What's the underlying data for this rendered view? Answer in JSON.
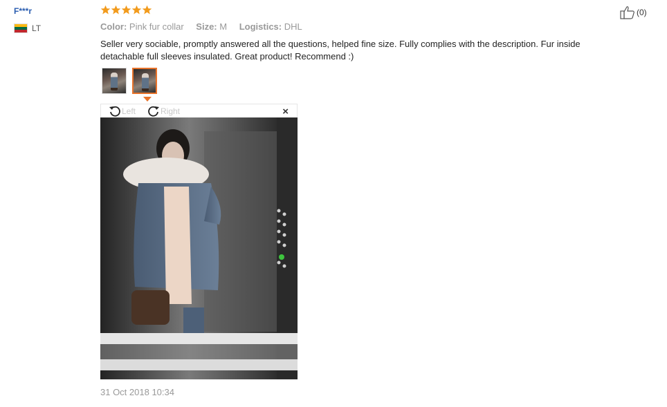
{
  "reviewer": {
    "name": "F***r",
    "country_code": "LT",
    "flag_colors": [
      "#fdb913",
      "#006a44",
      "#c1272d"
    ]
  },
  "rating": {
    "stars": 5,
    "max": 5,
    "star_color": "#f29b1d"
  },
  "attributes": [
    {
      "key": "Color:",
      "value": "Pink fur collar"
    },
    {
      "key": "Size:",
      "value": "M"
    },
    {
      "key": "Logistics:",
      "value": "DHL"
    }
  ],
  "review": {
    "text": "Seller very sociable, promptly answered all the questions, helped fine size. Fully complies with the description. Fur inside detachable full sleeves insulated. Great product! Recommend :)",
    "date": "31 Oct 2018 10:34"
  },
  "images": {
    "count": 2,
    "active_index": 1,
    "accent_color": "#e8732a"
  },
  "viewer": {
    "rotate_left_label": "Left",
    "rotate_right_label": "Right",
    "close_symbol": "×"
  },
  "helpful": {
    "icon": "thumbs-up-icon",
    "count_label": "(0)"
  }
}
